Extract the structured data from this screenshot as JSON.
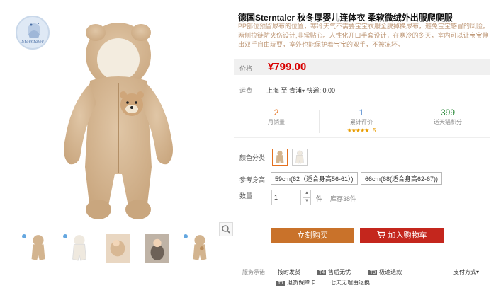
{
  "brand_badge": {
    "text": "Sterntaler"
  },
  "product": {
    "title_prefix": "德国Sterntaler",
    "title_suffix": " 秋冬厚婴儿连体衣 柔软微绒外出服爬爬服",
    "description": "PP部位预留尿布的位置，寒冷天气不需要宝宝衣服全脱掉换尿布，避免宝宝感冒的风险。两侧拉链防夹伤设计,非常贴心。人性化开口手套设计，在寒冷的冬天，室内可以让宝宝伸出双手自由玩耍，室外也能保护着宝宝的双手，不被冻坏。"
  },
  "price": {
    "label": "价格",
    "value": "¥799.00"
  },
  "shipping": {
    "label": "运费",
    "from": "上海 至 青浦",
    "caret": "▾",
    "fee": "快递: 0.00"
  },
  "stats": [
    {
      "value": "2",
      "label": "月销量",
      "color": "#e4701e"
    },
    {
      "value": "1",
      "label": "累计评价",
      "color": "#3a7bc8",
      "stars": "★★★★★",
      "score": "5"
    },
    {
      "value": "399",
      "label": "送天猫积分",
      "color": "#2e8b3d"
    }
  ],
  "color_option": {
    "label": "颜色分类"
  },
  "size_option": {
    "label": "参考身高",
    "choices": [
      "59cm(62（适合身高56-61）)",
      "66cm(68(适合身高62-67))"
    ]
  },
  "quantity": {
    "label": "数量",
    "value": "1",
    "unit": "件",
    "stock": "库存38件",
    "up": "▲",
    "down": "▼"
  },
  "buttons": {
    "buy": "立刻购买",
    "cart": "加入购物车"
  },
  "services": {
    "label": "服务承诺",
    "items": [
      {
        "tag": "",
        "text": "按时发货"
      },
      {
        "tag": "T4",
        "text": "售后无忧"
      },
      {
        "tag": "T3",
        "text": "极速退款"
      },
      {
        "tag": "T1",
        "text": "退货保障卡"
      },
      {
        "tag": "",
        "text": "七天无理由退换"
      }
    ]
  },
  "payment": {
    "label": "支付方式",
    "caret": "▾"
  },
  "colors": {
    "price_red": "#d80000",
    "buy_orange": "#c9722a",
    "cart_red": "#c4261d",
    "suit_beige": "#d3b48f"
  }
}
